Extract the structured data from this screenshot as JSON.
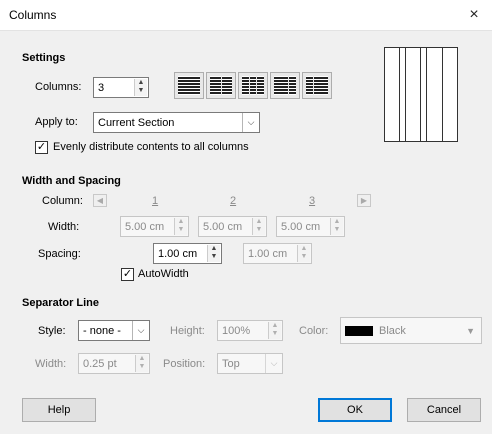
{
  "dialog": {
    "title": "Columns",
    "close_glyph": "×"
  },
  "settings": {
    "heading": "Settings",
    "columns_label": "Columns:",
    "columns_value": "3",
    "apply_to_label": "Apply to:",
    "apply_to_value": "Current Section",
    "evenly_label": "Evenly distribute contents to all columns",
    "evenly_checked": true
  },
  "presets": [
    {
      "name": "1 column"
    },
    {
      "name": "2 columns"
    },
    {
      "name": "3 columns"
    },
    {
      "name": "2 columns left-wide"
    },
    {
      "name": "2 columns right-wide"
    }
  ],
  "width_spacing": {
    "heading": "Width and Spacing",
    "column_label": "Column:",
    "column_numbers": [
      "1",
      "2",
      "3"
    ],
    "width_label": "Width:",
    "widths": [
      "5.00 cm",
      "5.00 cm",
      "5.00 cm"
    ],
    "spacing_label": "Spacing:",
    "spacings": [
      "1.00 cm",
      "1.00 cm"
    ],
    "autowidth_label": "AutoWidth",
    "autowidth_checked": true
  },
  "separator": {
    "heading": "Separator Line",
    "style_label": "Style:",
    "style_value": "- none -",
    "height_label": "Height:",
    "height_value": "100%",
    "color_label": "Color:",
    "color_value": "Black",
    "color_hex": "#000000",
    "width_label": "Width:",
    "width_value": "0.25 pt",
    "position_label": "Position:",
    "position_value": "Top"
  },
  "buttons": {
    "help": "Help",
    "ok": "OK",
    "cancel": "Cancel"
  },
  "colors": {
    "accent": "#0078d7",
    "dialog_bg": "#f0f0f0"
  }
}
